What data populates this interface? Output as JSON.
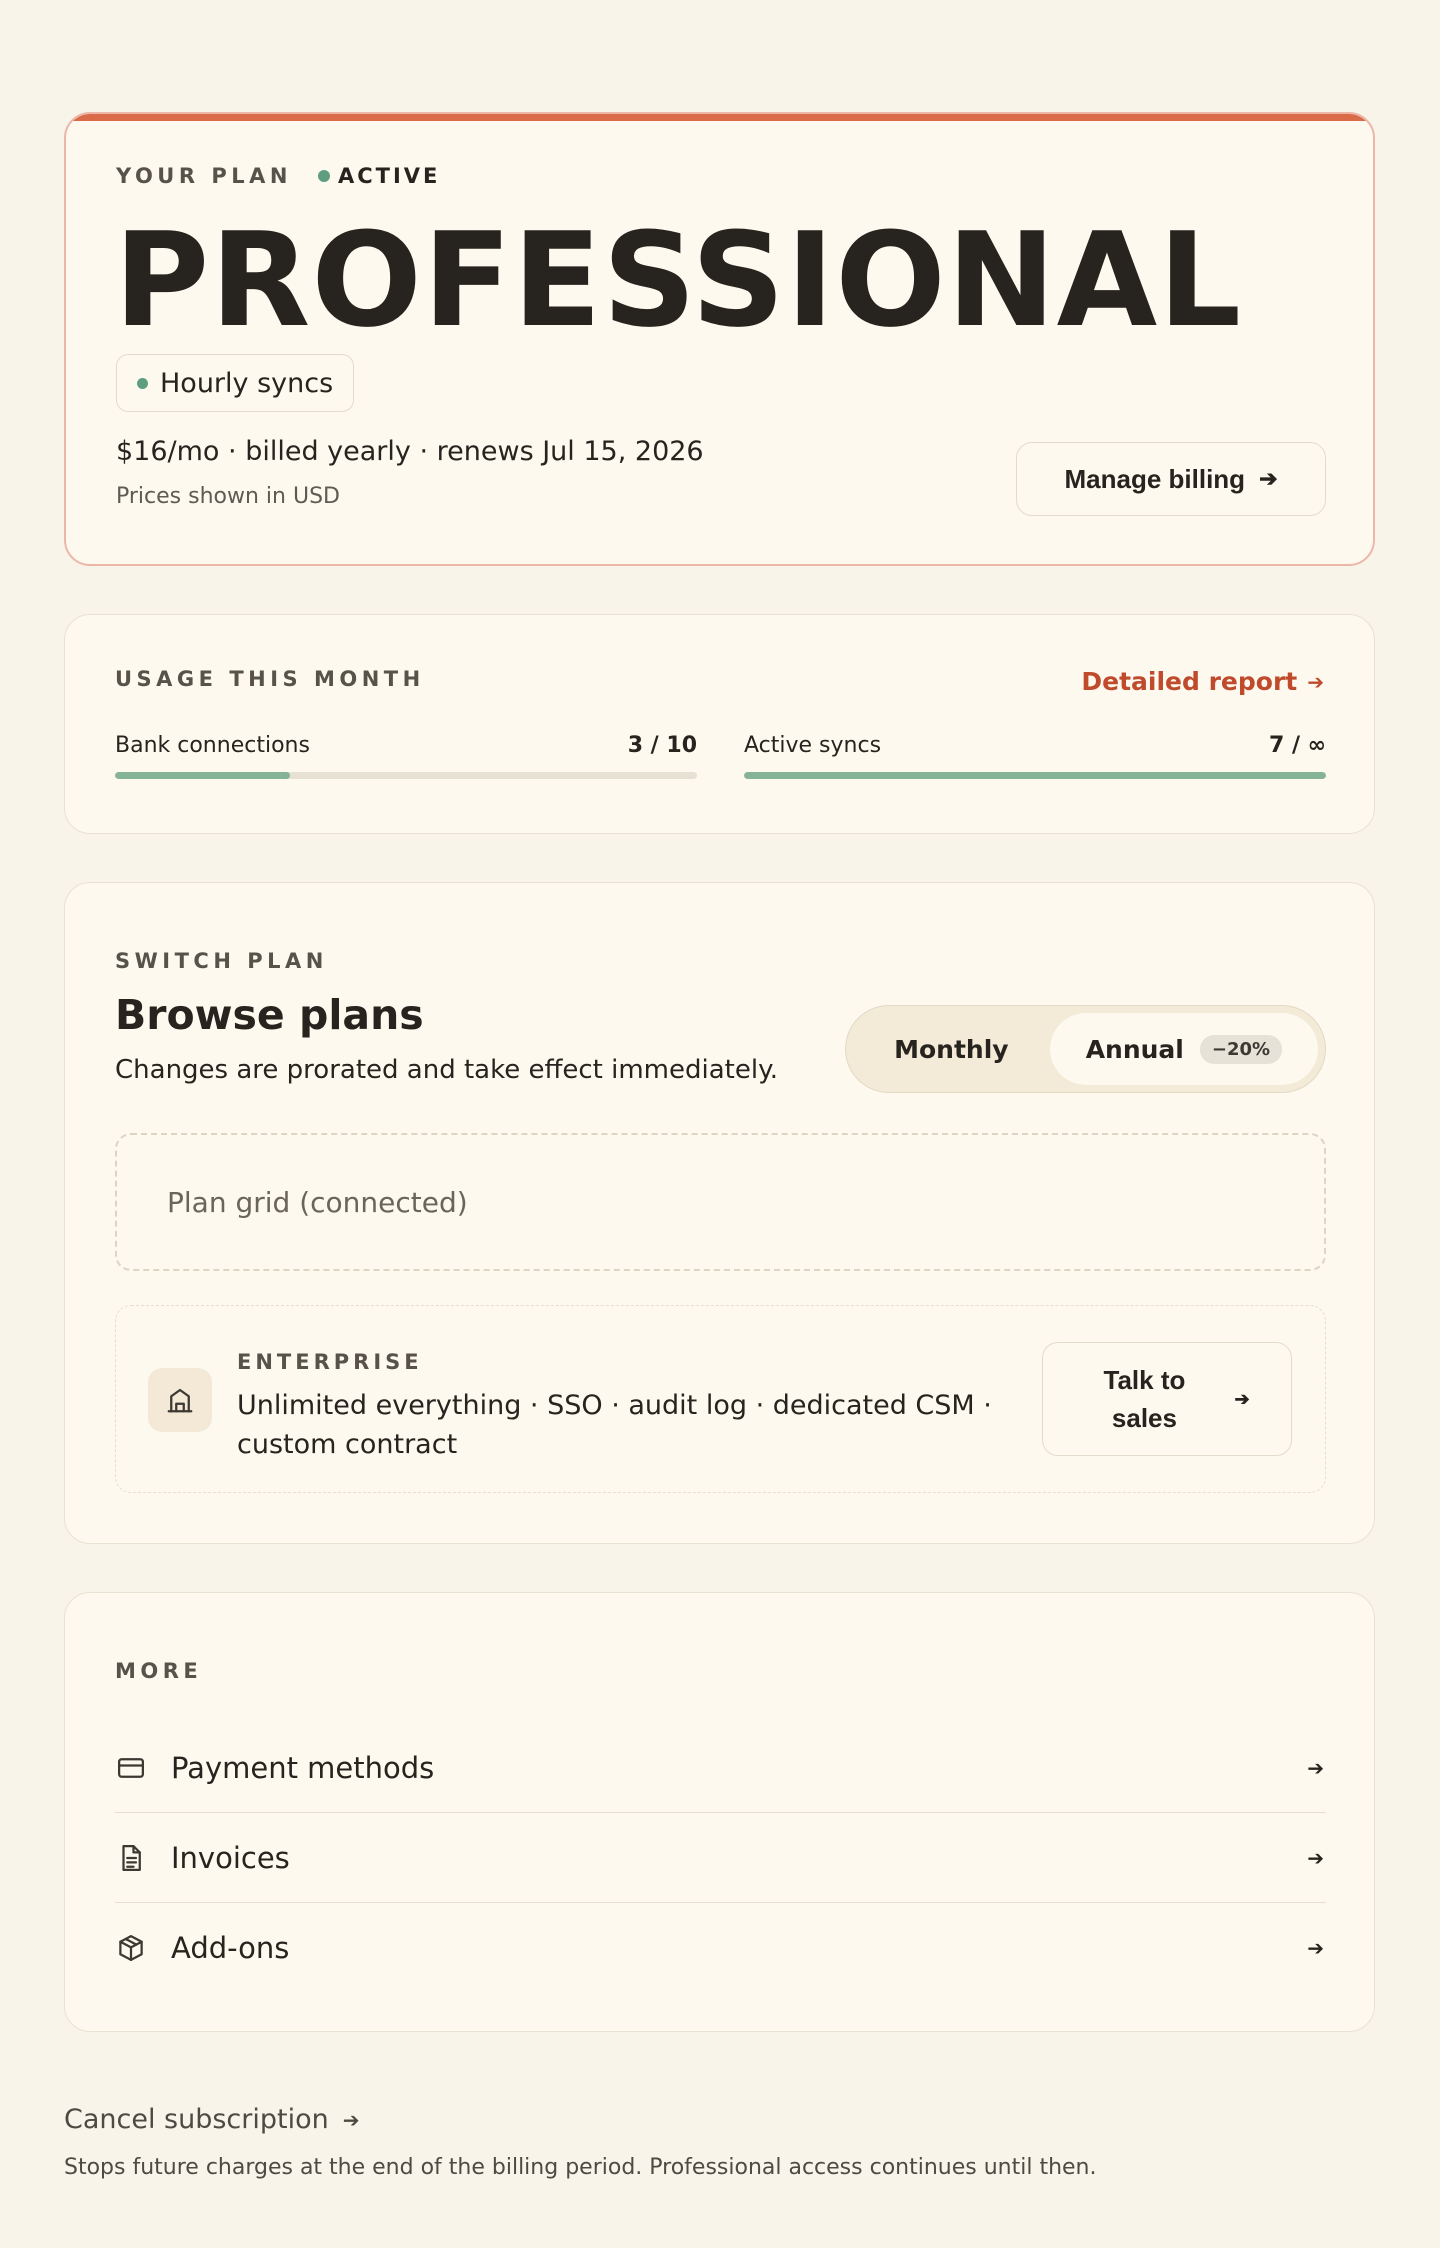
{
  "plan": {
    "eyebrow": "YOUR PLAN",
    "status": "ACTIVE",
    "name": "PROFESSIONAL",
    "feature_chip": "Hourly syncs",
    "price_line": "$16/mo · billed yearly · renews Jul 15, 2026",
    "currency_note": "Prices shown in USD",
    "manage_label": "Manage billing",
    "accent_color": "#d96b49",
    "status_color": "#5e9d80"
  },
  "usage": {
    "eyebrow": "USAGE THIS MONTH",
    "report_label": "Detailed report",
    "meters": [
      {
        "label": "Bank connections",
        "value": "3 / 10",
        "fraction": 0.3
      },
      {
        "label": "Active syncs",
        "value": "7 / ∞",
        "fraction": 1.0
      }
    ],
    "fill_color": "#85b398"
  },
  "switch": {
    "eyebrow": "SWITCH PLAN",
    "title": "Browse plans",
    "subtitle": "Changes are prorated and take effect immediately.",
    "toggle": {
      "monthly": "Monthly",
      "annual": "Annual",
      "discount": "−20%",
      "selected": "annual"
    },
    "grid_placeholder": "Plan grid (connected)",
    "enterprise": {
      "eyebrow": "ENTERPRISE",
      "text": "Unlimited everything · SSO · audit log · dedicated CSM · custom contract",
      "cta": "Talk to sales",
      "icon": "building-icon"
    }
  },
  "more": {
    "eyebrow": "MORE",
    "items": [
      {
        "label": "Payment methods",
        "icon": "credit-card-icon"
      },
      {
        "label": "Invoices",
        "icon": "document-icon"
      },
      {
        "label": "Add-ons",
        "icon": "package-icon"
      }
    ]
  },
  "footer": {
    "cancel_label": "Cancel subscription",
    "cancel_note": "Stops future charges at the end of the billing period. Professional access continues until then."
  }
}
